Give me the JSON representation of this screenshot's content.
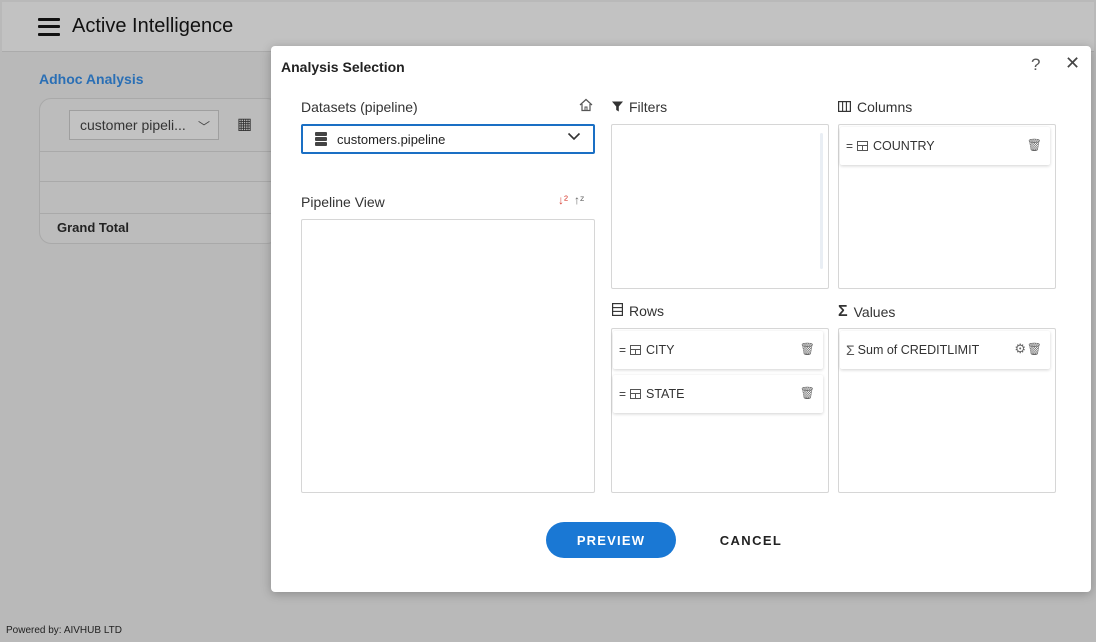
{
  "app": {
    "title": "Active Intelligence",
    "footer": "Powered by: AIVHUB LTD"
  },
  "background": {
    "section_title": "Adhoc Analysis",
    "dataset_select_value": "customer pipeli...",
    "grand_total_label": "Grand Total"
  },
  "dialog": {
    "title": "Analysis Selection",
    "help_label": "?",
    "close_label": "✕",
    "datasets": {
      "label": "Datasets (pipeline)",
      "selected": "customers.pipeline"
    },
    "pipeline_view": {
      "label": "Pipeline View"
    },
    "filters": {
      "label": "Filters",
      "items": []
    },
    "columns": {
      "label": "Columns",
      "items": [
        "COUNTRY"
      ]
    },
    "rows": {
      "label": "Rows",
      "items": [
        "CITY",
        "STATE"
      ]
    },
    "values": {
      "label": "Values",
      "items": [
        "Sum of CREDITLIMIT"
      ]
    },
    "buttons": {
      "preview": "PREVIEW",
      "cancel": "CANCEL"
    }
  },
  "colors": {
    "accent": "#1a78d4",
    "link": "#2a6fb5",
    "sort_desc": "#d9463b"
  },
  "icons": [
    "hamburger-icon",
    "home-icon",
    "filter-icon",
    "columns-icon",
    "rows-icon",
    "sigma-icon",
    "sort-desc-icon",
    "sort-asc-icon",
    "trash-icon",
    "gear-icon",
    "table-icon",
    "drag-handle-icon",
    "database-icon",
    "chevron-down-icon",
    "help-icon",
    "close-icon"
  ]
}
